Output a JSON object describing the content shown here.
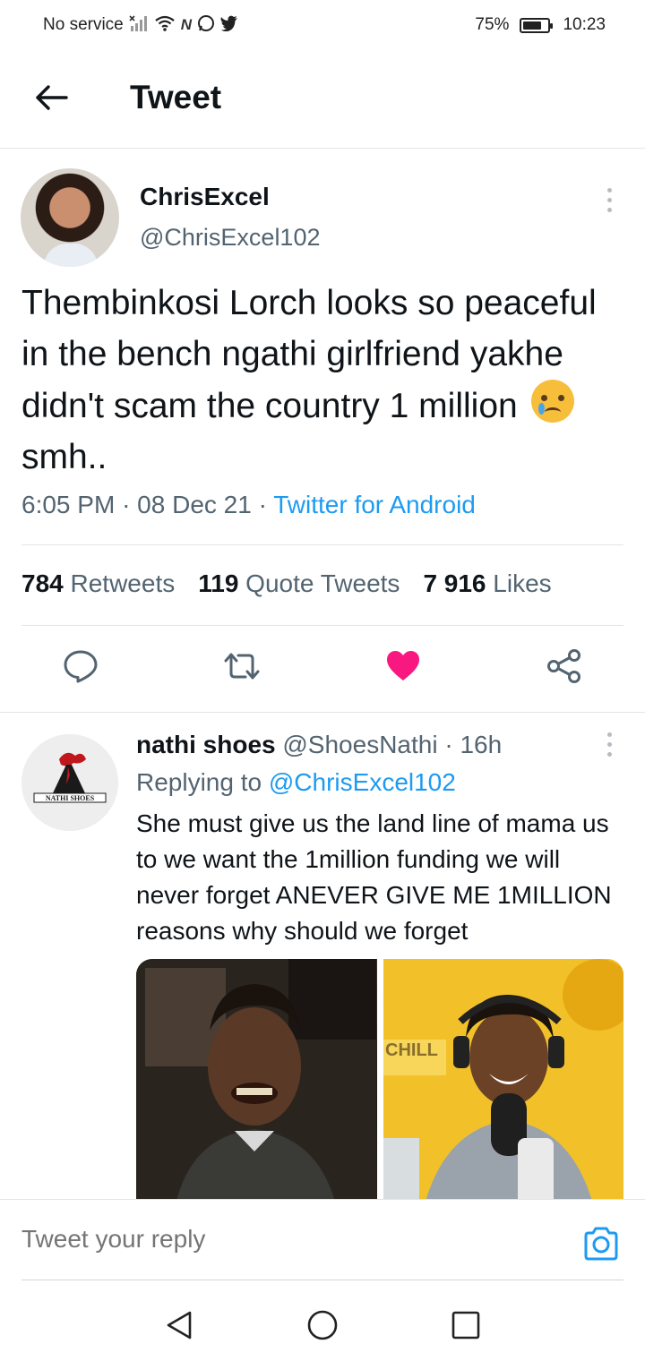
{
  "status_bar": {
    "carrier": "No service",
    "battery_percent": "75%",
    "battery_level": 0.75,
    "time": "10:23"
  },
  "header": {
    "title": "Tweet"
  },
  "tweet": {
    "display_name": "ChrisExcel",
    "handle": "@ChrisExcel102",
    "text_before_emoji": "Thembinkosi Lorch looks so peaceful in the bench ngathi girlfriend yakhe didn't scam the country 1 million",
    "text_after_emoji": "smh..",
    "emoji": "crying-face",
    "time": "6:05 PM",
    "date": "08 Dec 21",
    "separator": "·",
    "source": "Twitter for Android",
    "stats": {
      "retweets_count": "784",
      "retweets_label": "Retweets",
      "quotes_count": "119",
      "quotes_label": "Quote Tweets",
      "likes_count": "7 916",
      "likes_label": "Likes"
    }
  },
  "reply": {
    "display_name": "nathi shoes",
    "handle": "@ShoesNathi",
    "age": "16h",
    "separator": "·",
    "replying_label": "Replying to",
    "replying_to": "@ChrisExcel102",
    "text": "She must give us the land line of mama us to we want the 1million funding we will never forget ANEVER GIVE ME 1MILLION reasons why should we forget",
    "avatar_text": "NATHI SHOES",
    "media_label_right": "CHILL"
  },
  "compose": {
    "placeholder": "Tweet your reply"
  },
  "colors": {
    "accent": "#1d9bf0",
    "like": "#f91880",
    "muted": "#536471"
  }
}
